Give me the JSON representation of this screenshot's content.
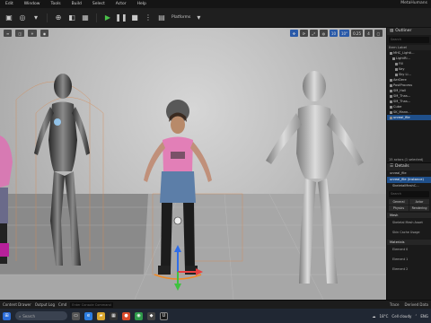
{
  "menubar": {
    "items": [
      "Edit",
      "Window",
      "Tools",
      "Build",
      "Select",
      "Actor",
      "Help"
    ],
    "project": "MetaHumans"
  },
  "toolbar": {
    "platforms_label": "Platforms"
  },
  "viewport": {
    "numbers": [
      "10",
      "10°",
      "0.25",
      "4"
    ]
  },
  "outliner": {
    "tab": "Outliner",
    "search_placeholder": "Search",
    "header": "Item Label",
    "items": [
      "MHC_Lighti...",
      "LightRi...",
      "Fill",
      "Key",
      "Sky Li...",
      "AerDere",
      "PostProcess",
      "SM_Hall",
      "SM_Thas...",
      "SM_Thas...",
      "Cube",
      "SK_Mann...",
      "unreal_file"
    ],
    "footer": "15 actors (1 selected)"
  },
  "details": {
    "tab": "Details",
    "rows": [
      "unreal_file",
      "unreal_file (Instance)",
      "SkeletalMeshC..."
    ],
    "search_placeholder": "Search",
    "filters": [
      "General",
      "Actor",
      "Physics",
      "Rendering"
    ],
    "sections": [
      "Mesh",
      "Materials"
    ],
    "mesh_props": [
      "Skeletal Mesh Asset",
      "Skin Cache Usage"
    ],
    "material_props": [
      "Element 0",
      "Element 1",
      "Element 2"
    ]
  },
  "bottombar": {
    "content_drawer": "Content Drawer",
    "output_log": "Output Log",
    "cmd": "Cmd",
    "cmd_placeholder": "Enter Console Command",
    "trace": "Trace",
    "derived_data": "Derived Data"
  },
  "taskbar": {
    "search_placeholder": "Search",
    "weather": "18°C",
    "weather_desc": "Cell cloudy",
    "lang": "ENG"
  },
  "colors": {
    "selection": "#1f4f8a",
    "play_green": "#4ac24a"
  }
}
